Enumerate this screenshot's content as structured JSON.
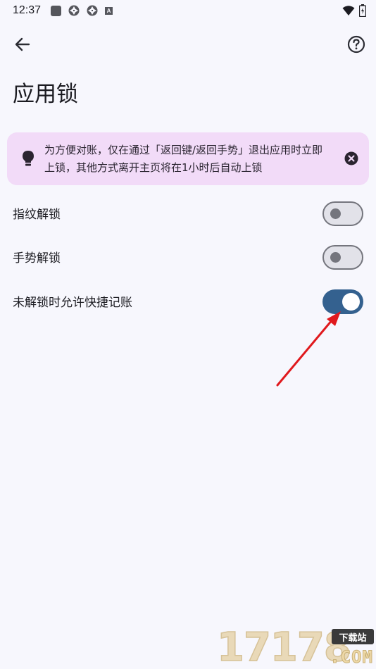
{
  "status_bar": {
    "time": "12:37",
    "notification_icons": [
      "square-icon",
      "aperture-icon",
      "aperture-icon",
      "a-icon"
    ],
    "a_icon_letter": "A",
    "right_icons": [
      "wifi-icon",
      "battery-icon"
    ]
  },
  "app_bar": {
    "title": "应用锁",
    "back_icon": "arrow-left-icon",
    "help_icon": "help-circle-icon"
  },
  "banner": {
    "icon": "lightbulb-icon",
    "text": "为方便对账，仅在通过「返回键/返回手势」退出应用时立即上锁，其他方式离开主页将在1小时后自动上锁",
    "close_icon": "close-circle-icon",
    "background": "#f2dbf8"
  },
  "settings": [
    {
      "label": "指纹解锁",
      "enabled": false
    },
    {
      "label": "手势解锁",
      "enabled": false
    },
    {
      "label": "未解锁时允许快捷记账",
      "enabled": true
    }
  ],
  "colors": {
    "accent": "#34618f",
    "background": "#f7f7fd",
    "annotation_arrow": "#e0191d"
  },
  "watermark": {
    "digits": "17178",
    "tag": "下载站",
    "suffix": ".COM"
  }
}
